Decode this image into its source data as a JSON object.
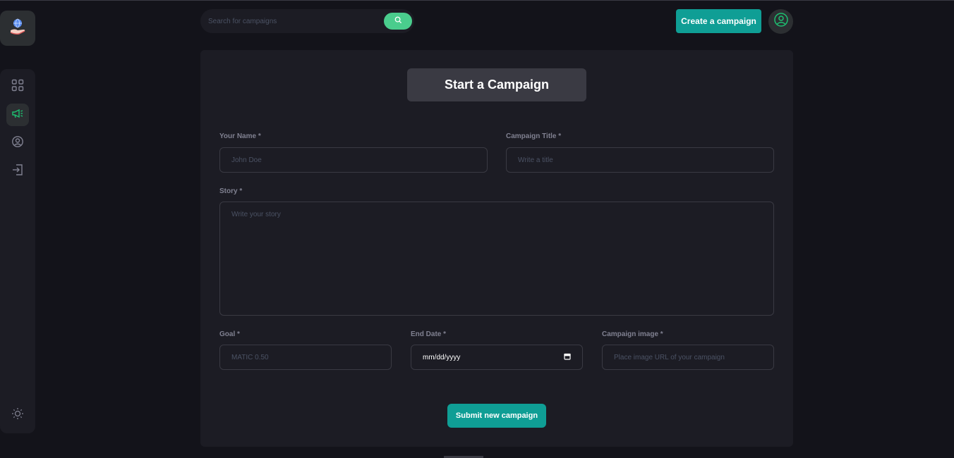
{
  "header": {
    "search": {
      "placeholder": "Search for campaigns",
      "value": ""
    },
    "search_button_icon": "search-icon",
    "create_button": "Create a campaign",
    "profile_icon": "user-circle-icon"
  },
  "sidebar": {
    "logo_icon": "globe-hand-icon",
    "items": [
      {
        "name": "dashboard",
        "icon": "grid-icon",
        "active": false
      },
      {
        "name": "campaign",
        "icon": "megaphone-icon",
        "active": true
      },
      {
        "name": "profile",
        "icon": "user-icon",
        "active": false
      },
      {
        "name": "logout",
        "icon": "logout-icon",
        "active": false
      }
    ],
    "theme_icon": "sun-icon"
  },
  "form": {
    "title": "Start a Campaign",
    "name": {
      "label": "Your Name *",
      "placeholder": "John Doe",
      "value": ""
    },
    "campaign_title": {
      "label": "Campaign Title *",
      "placeholder": "Write a title",
      "value": ""
    },
    "story": {
      "label": "Story *",
      "placeholder": "Write your story",
      "value": ""
    },
    "goal": {
      "label": "Goal *",
      "placeholder": "MATIC 0.50",
      "value": ""
    },
    "end_date": {
      "label": "End Date *",
      "placeholder": "mm/dd/yyyy"
    },
    "image": {
      "label": "Campaign image *",
      "placeholder": "Place image URL of your campaign",
      "value": ""
    },
    "submit": "Submit new campaign"
  },
  "colors": {
    "background": "#13131a",
    "card": "#1c1c24",
    "accent": "#0f9e95",
    "search_button": "#4acd8d",
    "active_icon": "#1dc071"
  }
}
